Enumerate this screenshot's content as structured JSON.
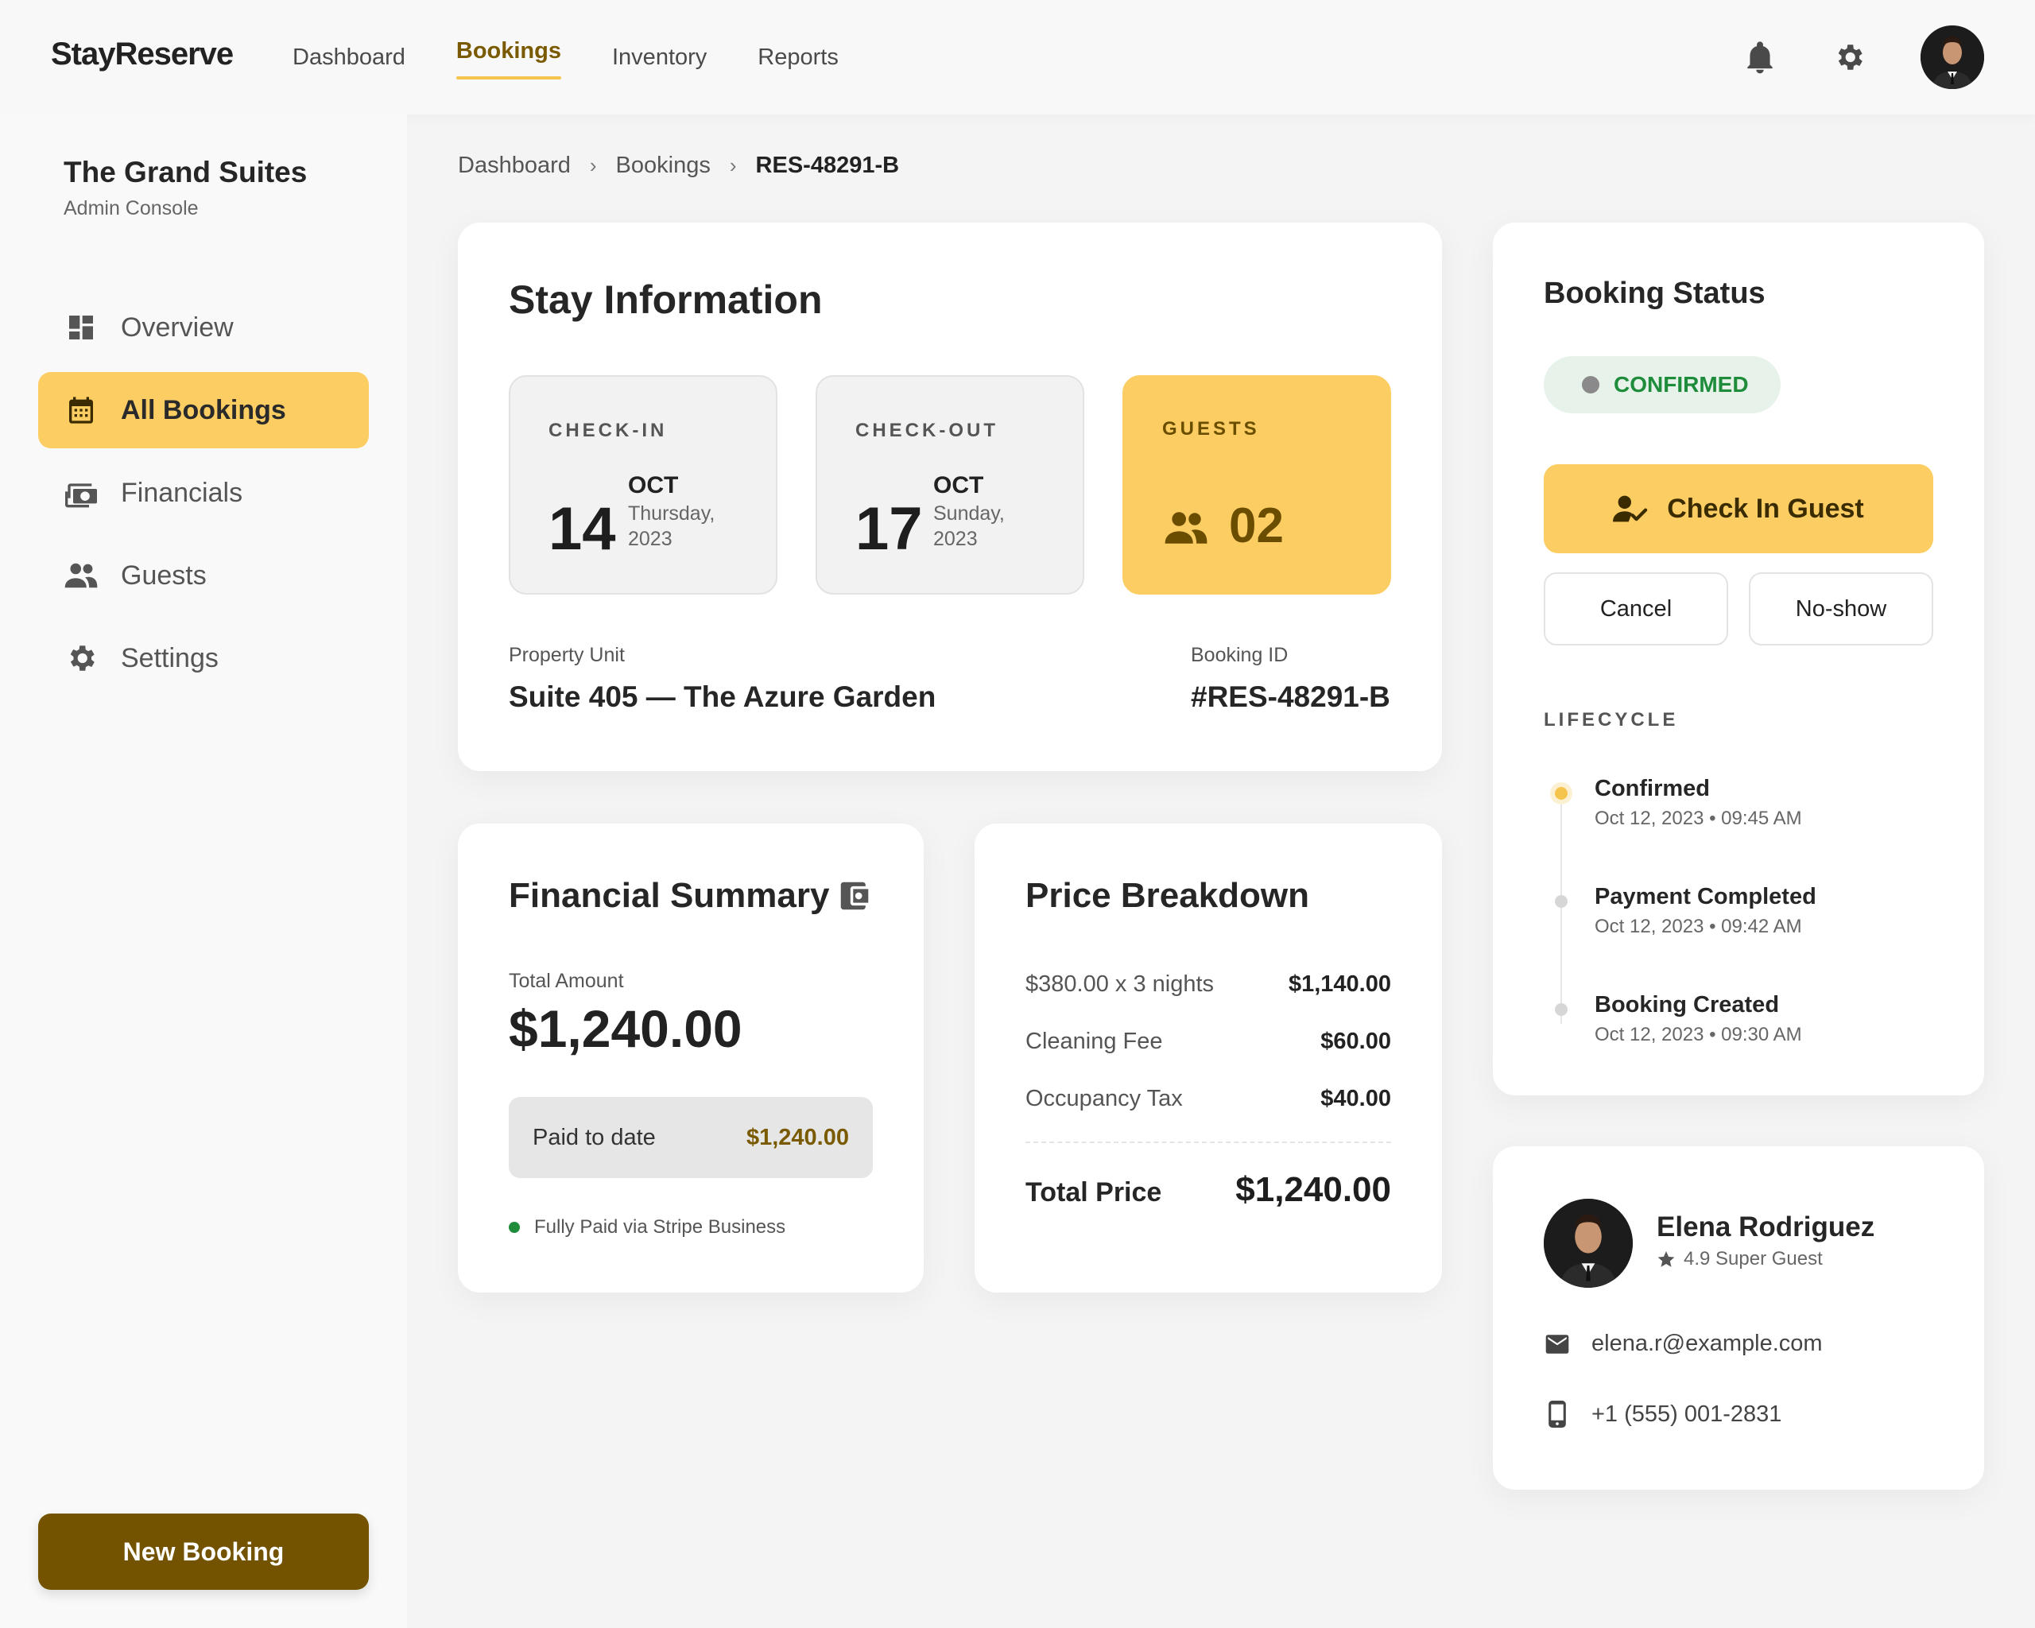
{
  "app": {
    "brand": "StayReserve"
  },
  "topnav": {
    "items": [
      {
        "label": "Dashboard",
        "active": false
      },
      {
        "label": "Bookings",
        "active": true
      },
      {
        "label": "Inventory",
        "active": false
      },
      {
        "label": "Reports",
        "active": false
      }
    ],
    "icons": [
      "bell-icon",
      "gear-icon",
      "user-avatar"
    ]
  },
  "sidebar": {
    "property_name": "The Grand Suites",
    "property_sub": "Admin Console",
    "items": [
      {
        "label": "Overview",
        "icon": "dashboard-icon",
        "active": false
      },
      {
        "label": "All Bookings",
        "icon": "calendar-icon",
        "active": true
      },
      {
        "label": "Financials",
        "icon": "payments-icon",
        "active": false
      },
      {
        "label": "Guests",
        "icon": "people-icon",
        "active": false
      },
      {
        "label": "Settings",
        "icon": "gear-icon",
        "active": false
      }
    ],
    "new_booking_label": "New Booking"
  },
  "breadcrumb": {
    "items": [
      "Dashboard",
      "Bookings",
      "RES-48291-B"
    ],
    "separator": "›"
  },
  "stay": {
    "title": "Stay Information",
    "checkin": {
      "label": "CHECK-IN",
      "day": "14",
      "month": "OCT",
      "weekday": "Thursday,",
      "year": "2023"
    },
    "checkout": {
      "label": "CHECK-OUT",
      "day": "17",
      "month": "OCT",
      "weekday": "Sunday,",
      "year": "2023"
    },
    "guests": {
      "label": "GUESTS",
      "count": "02"
    },
    "unit_label": "Property Unit",
    "unit_value": "Suite 405 — The Azure Garden",
    "booking_id_label": "Booking ID",
    "booking_id_value": "#RES-48291-B"
  },
  "financial": {
    "title": "Financial Summary",
    "total_label": "Total Amount",
    "total_value": "$1,240.00",
    "paid_label": "Paid to date",
    "paid_value": "$1,240.00",
    "note": "Fully Paid via Stripe Business"
  },
  "price": {
    "title": "Price Breakdown",
    "rows": [
      {
        "label": "$380.00 x 3 nights",
        "value": "$1,140.00"
      },
      {
        "label": "Cleaning Fee",
        "value": "$60.00"
      },
      {
        "label": "Occupancy Tax",
        "value": "$40.00"
      }
    ],
    "total_label": "Total Price",
    "total_value": "$1,240.00"
  },
  "status": {
    "title": "Booking Status",
    "badge": "CONFIRMED",
    "checkin_button": "Check In Guest",
    "cancel_button": "Cancel",
    "noshow_button": "No-show",
    "lifecycle_label": "LIFECYCLE",
    "lifecycle": [
      {
        "title": "Confirmed",
        "time": "Oct 12, 2023 • 09:45 AM",
        "active": true
      },
      {
        "title": "Payment Completed",
        "time": "Oct 12, 2023 • 09:42 AM",
        "active": false
      },
      {
        "title": "Booking Created",
        "time": "Oct 12, 2023 • 09:30 AM",
        "active": false
      }
    ]
  },
  "guest": {
    "name": "Elena Rodriguez",
    "rating": "4.9 Super Guest",
    "email": "elena.r@example.com",
    "phone": "+1 (555) 001-2831"
  },
  "colors": {
    "accent": "#fccd62",
    "accent_dark": "#745300",
    "success": "#1e8c3a",
    "success_bg": "#e7f3ea"
  }
}
